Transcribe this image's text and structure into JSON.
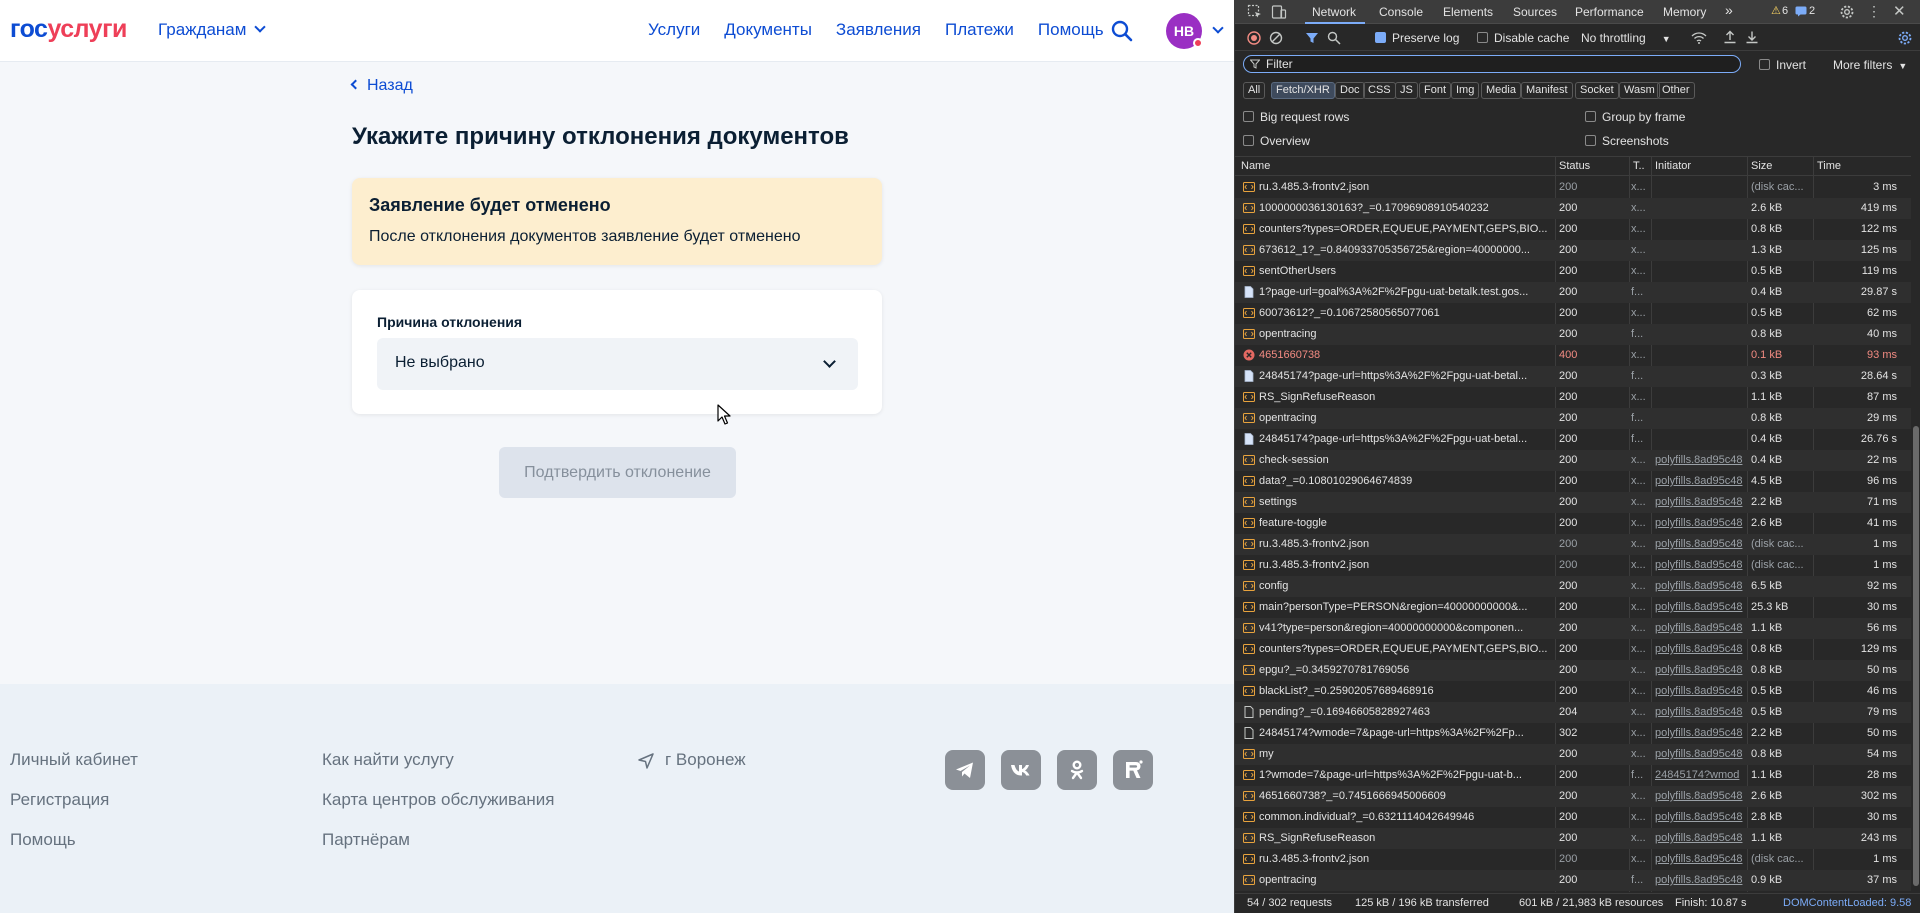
{
  "site": {
    "logo_part1": "гос",
    "logo_part2": "услуги",
    "citizens": "Гражданам",
    "nav": [
      "Услуги",
      "Документы",
      "Заявления",
      "Платежи",
      "Помощь"
    ],
    "avatar_initials": "НВ",
    "back": "Назад",
    "page_title": "Укажите причину отклонения документов",
    "warning": {
      "title": "Заявление будет отменено",
      "text": "После отклонения документов заявление будет отменено"
    },
    "field_label": "Причина отклонения",
    "select_value": "Не выбрано",
    "confirm_button": "Подтвердить отклонение",
    "footer": {
      "col1": [
        "Личный кабинет",
        "Регистрация",
        "Помощь"
      ],
      "col2": [
        "Как найти услугу",
        "Карта центров обслуживания",
        "Партнёрам"
      ],
      "city": "г Воронеж"
    },
    "colors": {
      "brand_blue": "#0d4cd3",
      "brand_red": "#ee3f58",
      "warning_bg": "#fdeecf"
    }
  },
  "devtools": {
    "tabs": [
      "Network",
      "Console",
      "Elements",
      "Sources",
      "Performance",
      "Memory"
    ],
    "warnings_count": "6",
    "issues_count": "2",
    "preserve_log": "Preserve log",
    "disable_cache": "Disable cache",
    "throttling": "No throttling",
    "filter_placeholder": "Filter",
    "invert": "Invert",
    "more_filters": "More filters",
    "chips": [
      "All",
      "Fetch/XHR",
      "Doc",
      "CSS",
      "JS",
      "Font",
      "Img",
      "Media",
      "Manifest",
      "Socket",
      "Wasm",
      "Other"
    ],
    "options": [
      "Big request rows",
      "Group by frame",
      "Overview",
      "Screenshots"
    ],
    "columns": [
      "Name",
      "Status",
      "T..",
      "Initiator",
      "Size",
      "Time"
    ],
    "rows": [
      {
        "icon": "xhr",
        "name": "ru.3.485.3-frontv2.json",
        "status": "200",
        "type": "x...",
        "initiator": "",
        "size": "(disk cac...",
        "time": "3 ms",
        "cached": true
      },
      {
        "icon": "xhr",
        "name": "1000000036130163?_=0.17096908910540232",
        "status": "200",
        "type": "x...",
        "initiator": "",
        "size": "2.6 kB",
        "time": "419 ms"
      },
      {
        "icon": "xhr",
        "name": "counters?types=ORDER,EQUEUE,PAYMENT,GEPS,BIO...",
        "status": "200",
        "type": "x...",
        "initiator": "",
        "size": "0.8 kB",
        "time": "122 ms"
      },
      {
        "icon": "xhr",
        "name": "673612_1?_=0.840933705356725&region=40000000...",
        "status": "200",
        "type": "x...",
        "initiator": "",
        "size": "1.3 kB",
        "time": "125 ms"
      },
      {
        "icon": "xhr",
        "name": "sentOtherUsers",
        "status": "200",
        "type": "x...",
        "initiator": "",
        "size": "0.5 kB",
        "time": "119 ms"
      },
      {
        "icon": "doc",
        "name": "1?page-url=goal%3A%2F%2Fpgu-uat-betalk.test.gos...",
        "status": "200",
        "type": "f...",
        "initiator": "",
        "size": "0.4 kB",
        "time": "29.87 s"
      },
      {
        "icon": "xhr",
        "name": "60073612?_=0.10672580565077061",
        "status": "200",
        "type": "x...",
        "initiator": "",
        "size": "0.5 kB",
        "time": "62 ms"
      },
      {
        "icon": "xhr",
        "name": "opentracing",
        "status": "200",
        "type": "f...",
        "initiator": "",
        "size": "0.8 kB",
        "time": "40 ms"
      },
      {
        "icon": "err",
        "name": "4651660738",
        "status": "400",
        "type": "x...",
        "initiator": "",
        "size": "0.1 kB",
        "time": "93 ms",
        "error": true
      },
      {
        "icon": "doc",
        "name": "24845174?page-url=https%3A%2F%2Fpgu-uat-betal...",
        "status": "200",
        "type": "f...",
        "initiator": "",
        "size": "0.3 kB",
        "time": "28.64 s"
      },
      {
        "icon": "xhr",
        "name": "RS_SignRefuseReason",
        "status": "200",
        "type": "x...",
        "initiator": "",
        "size": "1.1 kB",
        "time": "87 ms"
      },
      {
        "icon": "xhr",
        "name": "opentracing",
        "status": "200",
        "type": "f...",
        "initiator": "",
        "size": "0.8 kB",
        "time": "29 ms"
      },
      {
        "icon": "doc",
        "name": "24845174?page-url=https%3A%2F%2Fpgu-uat-betal...",
        "status": "200",
        "type": "f...",
        "initiator": "",
        "size": "0.4 kB",
        "time": "26.76 s"
      },
      {
        "icon": "xhr",
        "name": "check-session",
        "status": "200",
        "type": "x...",
        "initiator": "polyfills.8ad95c48",
        "size": "0.4 kB",
        "time": "22 ms"
      },
      {
        "icon": "xhr",
        "name": "data?_=0.10801029064674839",
        "status": "200",
        "type": "x...",
        "initiator": "polyfills.8ad95c48",
        "size": "4.5 kB",
        "time": "96 ms"
      },
      {
        "icon": "xhr",
        "name": "settings",
        "status": "200",
        "type": "x...",
        "initiator": "polyfills.8ad95c48",
        "size": "2.2 kB",
        "time": "71 ms"
      },
      {
        "icon": "xhr",
        "name": "feature-toggle",
        "status": "200",
        "type": "x...",
        "initiator": "polyfills.8ad95c48",
        "size": "2.6 kB",
        "time": "41 ms"
      },
      {
        "icon": "xhr",
        "name": "ru.3.485.3-frontv2.json",
        "status": "200",
        "type": "x...",
        "initiator": "polyfills.8ad95c48",
        "size": "(disk cac...",
        "time": "1 ms",
        "cached": true
      },
      {
        "icon": "xhr",
        "name": "ru.3.485.3-frontv2.json",
        "status": "200",
        "type": "x...",
        "initiator": "polyfills.8ad95c48",
        "size": "(disk cac...",
        "time": "1 ms",
        "cached": true
      },
      {
        "icon": "xhr",
        "name": "config",
        "status": "200",
        "type": "x...",
        "initiator": "polyfills.8ad95c48",
        "size": "6.5 kB",
        "time": "92 ms"
      },
      {
        "icon": "xhr",
        "name": "main?personType=PERSON&region=40000000000&...",
        "status": "200",
        "type": "x...",
        "initiator": "polyfills.8ad95c48",
        "size": "25.3 kB",
        "time": "30 ms"
      },
      {
        "icon": "xhr",
        "name": "v41?type=person&region=40000000000&componen...",
        "status": "200",
        "type": "x...",
        "initiator": "polyfills.8ad95c48",
        "size": "1.1 kB",
        "time": "56 ms"
      },
      {
        "icon": "xhr",
        "name": "counters?types=ORDER,EQUEUE,PAYMENT,GEPS,BIO...",
        "status": "200",
        "type": "x...",
        "initiator": "polyfills.8ad95c48",
        "size": "0.8 kB",
        "time": "129 ms"
      },
      {
        "icon": "xhr",
        "name": "epgu?_=0.3459270781769056",
        "status": "200",
        "type": "x...",
        "initiator": "polyfills.8ad95c48",
        "size": "0.8 kB",
        "time": "50 ms"
      },
      {
        "icon": "xhr",
        "name": "blackList?_=0.25902057689468916",
        "status": "200",
        "type": "x...",
        "initiator": "polyfills.8ad95c48",
        "size": "0.5 kB",
        "time": "46 ms"
      },
      {
        "icon": "doc-plain",
        "name": "pending?_=0.16946605828927463",
        "status": "204",
        "type": "x...",
        "initiator": "polyfills.8ad95c48",
        "size": "0.5 kB",
        "time": "79 ms"
      },
      {
        "icon": "doc-plain",
        "name": "24845174?wmode=7&page-url=https%3A%2F%2Fp...",
        "status": "302",
        "type": "x...",
        "initiator": "polyfills.8ad95c48",
        "size": "2.2 kB",
        "time": "50 ms"
      },
      {
        "icon": "xhr",
        "name": "my",
        "status": "200",
        "type": "x...",
        "initiator": "polyfills.8ad95c48",
        "size": "0.8 kB",
        "time": "54 ms"
      },
      {
        "icon": "xhr",
        "name": "1?wmode=7&page-url=https%3A%2F%2Fpgu-uat-b...",
        "status": "200",
        "type": "f...",
        "initiator": "24845174?wmod",
        "size": "1.1 kB",
        "time": "28 ms"
      },
      {
        "icon": "xhr",
        "name": "4651660738?_=0.7451666945006609",
        "status": "200",
        "type": "x...",
        "initiator": "polyfills.8ad95c48",
        "size": "2.6 kB",
        "time": "302 ms"
      },
      {
        "icon": "xhr",
        "name": "common.individual?_=0.6321114042649946",
        "status": "200",
        "type": "x...",
        "initiator": "polyfills.8ad95c48",
        "size": "2.8 kB",
        "time": "30 ms"
      },
      {
        "icon": "xhr",
        "name": "RS_SignRefuseReason",
        "status": "200",
        "type": "x...",
        "initiator": "polyfills.8ad95c48",
        "size": "1.1 kB",
        "time": "243 ms"
      },
      {
        "icon": "xhr",
        "name": "ru.3.485.3-frontv2.json",
        "status": "200",
        "type": "x...",
        "initiator": "polyfills.8ad95c48",
        "size": "(disk cac...",
        "time": "1 ms",
        "cached": true
      },
      {
        "icon": "xhr",
        "name": "opentracing",
        "status": "200",
        "type": "f...",
        "initiator": "polyfills.8ad95c48",
        "size": "0.9 kB",
        "time": "37 ms"
      }
    ],
    "status_bar": {
      "requests": "54 / 302 requests",
      "transferred": "125 kB / 196 kB transferred",
      "resources": "601 kB / 21,983 kB resources",
      "finish": "Finish: 10.87 s",
      "dcl": "DOMContentLoaded: 9.58"
    },
    "colors": {
      "accent": "#7cacf8",
      "error": "#f28b82",
      "bg": "#282828"
    }
  }
}
